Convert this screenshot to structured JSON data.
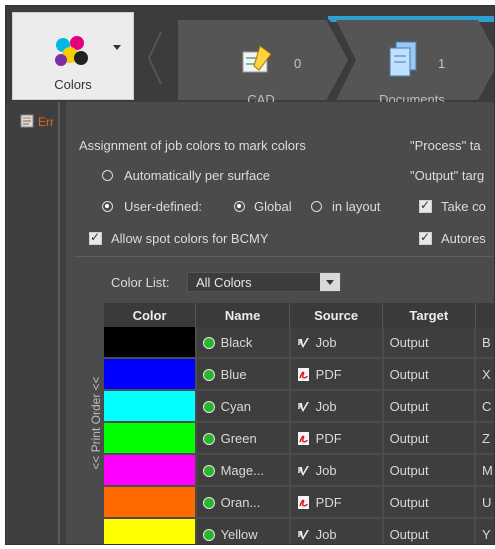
{
  "toolbar": {
    "colors_label": "Colors",
    "steps": [
      {
        "label": "CAD",
        "count": "0"
      },
      {
        "label": "Documents",
        "count": "1"
      }
    ]
  },
  "sidebar": {
    "tab_label": "Err"
  },
  "assignment": {
    "heading": "Assignment of job colors to mark colors",
    "auto_label": "Automatically per surface",
    "user_defined_label": "User-defined:",
    "global_label": "Global",
    "in_layout_label": "in layout",
    "allow_spot_label": "Allow spot colors for BCMY",
    "auto_selected": false,
    "user_defined_selected": true,
    "global_selected": true,
    "allow_spot_checked": true
  },
  "right_options": {
    "process_label": "\"Process\" ta",
    "output_label": "\"Output\" targ",
    "take_label": "Take co",
    "autores_label": "Autores",
    "take_checked": true,
    "autores_checked": true
  },
  "color_list": {
    "label": "Color List:",
    "selected": "All Colors",
    "print_order_label": "<< Print Order <<",
    "columns": [
      "Color",
      "Name",
      "Source",
      "Target"
    ],
    "rows": [
      {
        "swatch": "#000000",
        "name": "Black",
        "source": "Job",
        "source_icon": "job-icon",
        "target": "Output",
        "extra": "B"
      },
      {
        "swatch": "#0000ff",
        "name": "Blue",
        "source": "PDF",
        "source_icon": "pdf-icon",
        "target": "Output",
        "extra": "X"
      },
      {
        "swatch": "#00ffff",
        "name": "Cyan",
        "source": "Job",
        "source_icon": "job-icon",
        "target": "Output",
        "extra": "C"
      },
      {
        "swatch": "#00ff00",
        "name": "Green",
        "source": "PDF",
        "source_icon": "pdf-icon",
        "target": "Output",
        "extra": "Z"
      },
      {
        "swatch": "#ff00ff",
        "name": "Mage...",
        "source": "Job",
        "source_icon": "job-icon",
        "target": "Output",
        "extra": "M"
      },
      {
        "swatch": "#ff6a00",
        "name": "Oran...",
        "source": "PDF",
        "source_icon": "pdf-icon",
        "target": "Output",
        "extra": "U"
      },
      {
        "swatch": "#ffff00",
        "name": "Yellow",
        "source": "Job",
        "source_icon": "job-icon",
        "target": "Output",
        "extra": "Y"
      }
    ]
  }
}
